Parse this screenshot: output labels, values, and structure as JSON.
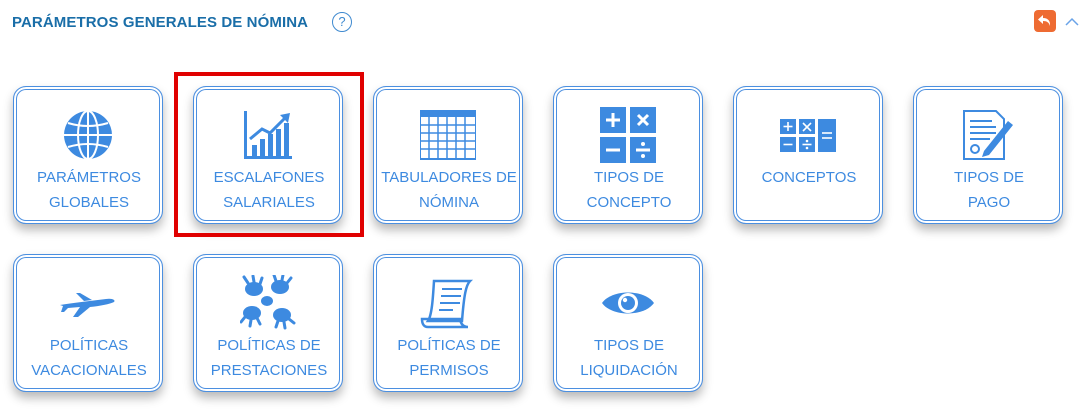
{
  "header": {
    "title": "PARÁMETROS GENERALES DE NÓMINA",
    "help_glyph": "?",
    "back_icon": "undo-arrow-icon",
    "collapse_icon": "chevron-up-icon"
  },
  "colors": {
    "accent": "#3d8ae0",
    "title": "#1a6ea8",
    "back_button": "#ee6b32",
    "highlight": "#e00000"
  },
  "cards": [
    {
      "icon": "globe-icon",
      "line1": "PARÁMETROS",
      "line2": "GLOBALES"
    },
    {
      "icon": "bar-chart-icon",
      "line1": "ESCALAFONES",
      "line2": "SALARIALES"
    },
    {
      "icon": "table-grid-icon",
      "line1": "TABULADORES DE",
      "line2": "NÓMINA"
    },
    {
      "icon": "math-operators-icon",
      "line1": "TIPOS DE",
      "line2": "CONCEPTO"
    },
    {
      "icon": "calculator-icon",
      "line1": "CONCEPTOS",
      "line2": ""
    },
    {
      "icon": "contract-pen-icon",
      "line1": "TIPOS DE",
      "line2": "PAGO"
    },
    {
      "icon": "airplane-icon",
      "line1": "POLÍTICAS",
      "line2": "VACACIONALES"
    },
    {
      "icon": "hands-icon",
      "line1": "POLÍTICAS DE",
      "line2": "PRESTACIONES"
    },
    {
      "icon": "scroll-icon",
      "line1": "POLÍTICAS DE",
      "line2": "PERMISOS"
    },
    {
      "icon": "eye-icon",
      "line1": "TIPOS DE",
      "line2": "LIQUIDACIÓN"
    }
  ],
  "highlighted_card": "ESCALAFONES SALARIALES"
}
